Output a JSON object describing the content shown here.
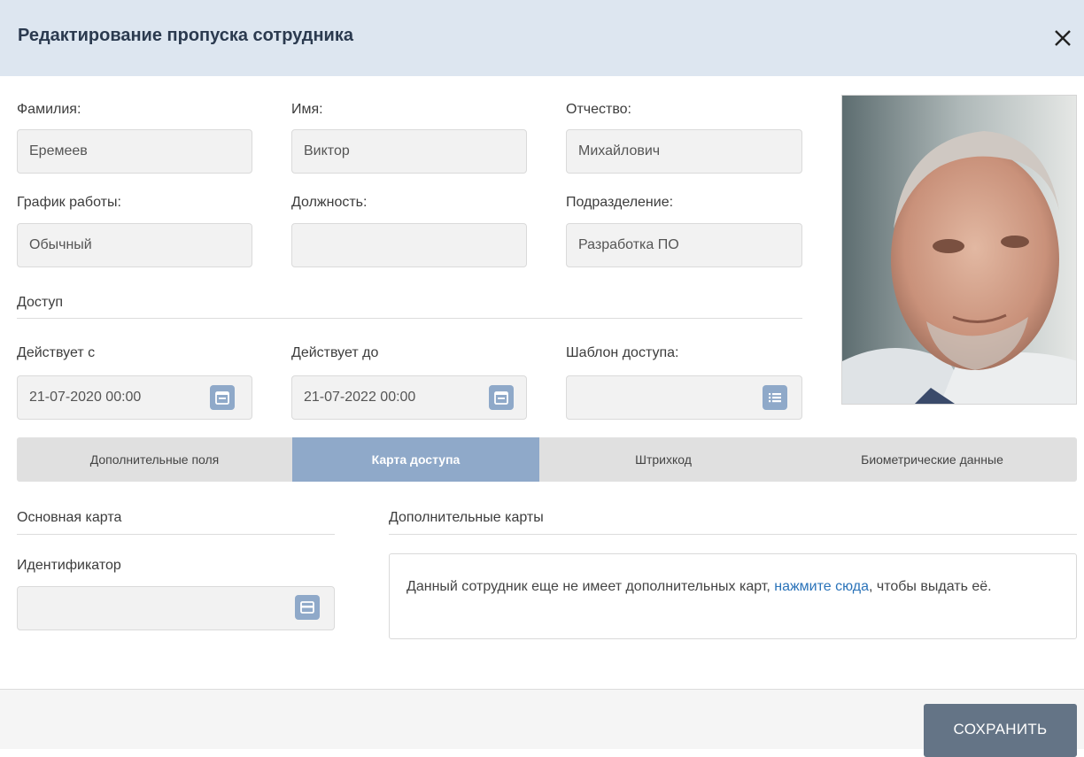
{
  "dialog": {
    "title": "Редактирование пропуска сотрудника",
    "close_icon": "close-icon"
  },
  "fields": {
    "last_name": {
      "label": "Фамилия:",
      "value": "Еремеев"
    },
    "first_name": {
      "label": "Имя:",
      "value": "Виктор"
    },
    "middle_name": {
      "label": "Отчество:",
      "value": "Михайлович"
    },
    "schedule": {
      "label": "График работы:",
      "value": "Обычный"
    },
    "position": {
      "label": "Должность:",
      "value": ""
    },
    "department": {
      "label": "Подразделение:",
      "value": "Разработка ПО"
    }
  },
  "access": {
    "section_title": "Доступ",
    "valid_from": {
      "label": "Действует с",
      "value": "21-07-2020 00:00"
    },
    "valid_to": {
      "label": "Действует до",
      "value": "21-07-2022 00:00"
    },
    "template": {
      "label": "Шаблон доступа:",
      "value": ""
    }
  },
  "tabs": [
    {
      "label": "Дополнительные поля",
      "active": false
    },
    {
      "label": "Карта доступа",
      "active": true
    },
    {
      "label": "Штрихкод",
      "active": false
    },
    {
      "label": "Биометрические данные",
      "active": false
    }
  ],
  "card": {
    "main_title": "Основная карта",
    "id_label": "Идентификатор",
    "id_value": "",
    "additional_title": "Дополнительные карты",
    "info_before": "Данный сотрудник еще не имеет дополнительных карт, ",
    "info_link": "нажмите сюда",
    "info_after": ", чтобы выдать её."
  },
  "footer": {
    "save_label": "СОХРАНИТЬ"
  },
  "colors": {
    "accent": "#8fa9c9",
    "header_bg": "#dde6f0",
    "save_bg": "#647486",
    "link": "#2a73b9"
  }
}
